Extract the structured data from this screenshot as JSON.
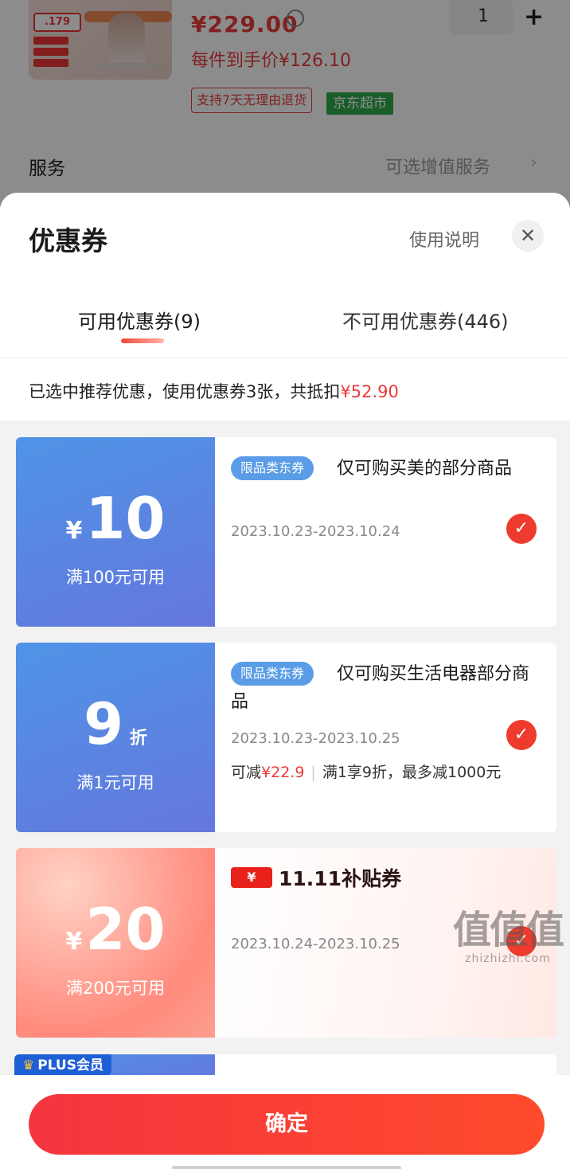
{
  "background": {
    "thumb_tag": ".179",
    "price": "¥229.00",
    "quantity": "1",
    "per_item_price": "每件到手价¥126.10",
    "return_policy": "支持7天无理由退货",
    "store_tag": "京东超市",
    "service_label": "服务",
    "service_value": "可选增值服务",
    "service_arrow": "›"
  },
  "sheet": {
    "title": "优惠券",
    "help_link": "使用说明",
    "close_glyph": "✕",
    "tabs": [
      {
        "label": "可用优惠券(9)",
        "active": true
      },
      {
        "label": "不可用优惠券(446)",
        "active": false
      }
    ],
    "summary_prefix": "已选中推荐优惠，使用优惠券3张，共抵扣",
    "summary_amount": "¥52.90"
  },
  "coupons": [
    {
      "yen": "¥",
      "amount": "10",
      "condition": "满100元可用",
      "badge": "限品类东券",
      "title": "仅可购买美的部分商品",
      "date": "2023.10.23-2023.10.24",
      "selected": true
    },
    {
      "amount": "9",
      "unit": "折",
      "condition": "满1元可用",
      "badge": "限品类东券",
      "title": "仅可购买生活电器部分商品",
      "date": "2023.10.23-2023.10.25",
      "extra_prefix": "可减",
      "extra_amount": "¥22.9",
      "extra_sep": "|",
      "extra_rule": "满1享9折，最多减1000元",
      "selected": true
    },
    {
      "yen": "¥",
      "amount": "20",
      "condition": "满200元可用",
      "logo_box": "¥",
      "logo_text": "11.11补贴券",
      "date": "2023.10.24-2023.10.25",
      "selected": true
    }
  ],
  "plus_tag": "PLUS会员",
  "plus_crown": "♛",
  "check_glyph": "✓",
  "confirm_button": "确定",
  "watermark": {
    "big": "值值值",
    "small": "zhizhizhi.com"
  },
  "colors": {
    "accent": "#e93b3b",
    "coupon_blue": "#5a8de4",
    "store_green": "#2faa4b"
  }
}
